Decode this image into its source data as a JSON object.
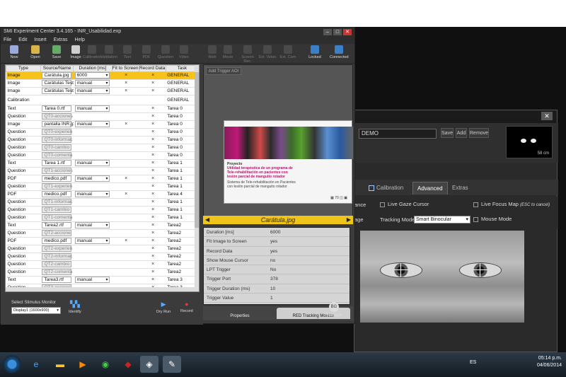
{
  "app": {
    "title": "SMI Experiment Center 3.4.165 - INR_Usabilidad.exp",
    "menu": [
      "File",
      "Edit",
      "Insert",
      "Extras",
      "Help"
    ]
  },
  "toolbar": {
    "items": [
      {
        "label": "New",
        "enabled": true
      },
      {
        "label": "Open",
        "enabled": true
      },
      {
        "label": "Save",
        "enabled": true
      },
      {
        "label": "Image",
        "enabled": true
      },
      {
        "label": "Calibration",
        "enabled": false
      },
      {
        "label": "Validation",
        "enabled": false
      },
      {
        "label": "Text",
        "enabled": false
      },
      {
        "label": "PDF",
        "enabled": false
      },
      {
        "label": "Question",
        "enabled": false
      },
      {
        "label": "Video",
        "enabled": false
      },
      {
        "label": "Web",
        "enabled": false
      },
      {
        "label": "Movie",
        "enabled": false
      },
      {
        "label": "Screen Rec.",
        "enabled": false
      },
      {
        "label": "Ext. Video",
        "enabled": false
      },
      {
        "label": "Ext. Cam",
        "enabled": false
      },
      {
        "label": "Locked",
        "enabled": true
      },
      {
        "label": "Connected",
        "enabled": true
      }
    ]
  },
  "table": {
    "headers": [
      "Type",
      "Source/Name",
      "Duration [ms]",
      "Fit to Screen",
      "Record Data",
      "Task"
    ],
    "rows": [
      {
        "type": "Image",
        "name": "Carátula.jpg",
        "duration": "6000",
        "fit": "×",
        "record": "×",
        "task": "GENERAL",
        "selected": true
      },
      {
        "type": "Image",
        "name": "Carátulas Test.",
        "duration": "manual",
        "fit": "×",
        "record": "×",
        "task": "GENERAL"
      },
      {
        "type": "Image",
        "name": "Carátulas Test1",
        "duration": "manual",
        "fit": "×",
        "record": "×",
        "task": "GENERAL"
      },
      {
        "type": "Calibration",
        "name": "",
        "duration": "",
        "fit": "",
        "record": "",
        "task": "GENERAL"
      },
      {
        "type": "Text",
        "name": "Tarea 0.rtf",
        "duration": "manual",
        "fit": "",
        "record": "×",
        "task": "Tarea 0"
      },
      {
        "type": "Question",
        "name": "QT0-acciones",
        "duration": "",
        "fit": "",
        "record": "×",
        "task": "Tarea 0"
      },
      {
        "type": "Image",
        "name": "pantalla INR.jp",
        "duration": "manual",
        "fit": "×",
        "record": "×",
        "task": "Tarea 0"
      },
      {
        "type": "Question",
        "name": "QT0-experien",
        "duration": "",
        "fit": "",
        "record": "×",
        "task": "Tarea 0"
      },
      {
        "type": "Question",
        "name": "QT0-informac",
        "duration": "",
        "fit": "",
        "record": "×",
        "task": "Tarea 0"
      },
      {
        "type": "Question",
        "name": "QT0-cambio",
        "duration": "",
        "fit": "",
        "record": "×",
        "task": "Tarea 0"
      },
      {
        "type": "Question",
        "name": "QT0-comenta",
        "duration": "",
        "fit": "",
        "record": "×",
        "task": "Tarea 0"
      },
      {
        "type": "Text",
        "name": "Tarea 1.rtf",
        "duration": "manual",
        "fit": "",
        "record": "×",
        "task": "Tarea 1"
      },
      {
        "type": "Question",
        "name": "QT1-acciones",
        "duration": "",
        "fit": "",
        "record": "×",
        "task": "Tarea 1"
      },
      {
        "type": "PDF",
        "name": "medico.pdf",
        "duration": "manual",
        "fit": "×",
        "record": "×",
        "task": "Tarea 1"
      },
      {
        "type": "Question",
        "name": "QT1-experien",
        "duration": "",
        "fit": "",
        "record": "×",
        "task": "Tarea 1"
      },
      {
        "type": "PDF",
        "name": "medico.pdf",
        "duration": "manual",
        "fit": "×",
        "record": "×",
        "task": "Tarea 4"
      },
      {
        "type": "Question",
        "name": "QT1-informac",
        "duration": "",
        "fit": "",
        "record": "×",
        "task": "Tarea 1"
      },
      {
        "type": "Question",
        "name": "QT1-cambio",
        "duration": "",
        "fit": "",
        "record": "×",
        "task": "Tarea 1"
      },
      {
        "type": "Question",
        "name": "QT1-comenta",
        "duration": "",
        "fit": "",
        "record": "×",
        "task": "Tarea 1"
      },
      {
        "type": "Text",
        "name": "Tarea2.rtf",
        "duration": "manual",
        "fit": "",
        "record": "×",
        "task": "Tarea2"
      },
      {
        "type": "Question",
        "name": "QT2-accione",
        "duration": "",
        "fit": "",
        "record": "×",
        "task": "Tarea2"
      },
      {
        "type": "PDF",
        "name": "medico.pdf",
        "duration": "manual",
        "fit": "×",
        "record": "×",
        "task": "Tarea2"
      },
      {
        "type": "Question",
        "name": "QT2-experien",
        "duration": "",
        "fit": "",
        "record": "×",
        "task": "Tarea2"
      },
      {
        "type": "Question",
        "name": "QT2-informac",
        "duration": "",
        "fit": "",
        "record": "×",
        "task": "Tarea2"
      },
      {
        "type": "Question",
        "name": "QT2-cambio",
        "duration": "",
        "fit": "",
        "record": "×",
        "task": "Tarea2"
      },
      {
        "type": "Question",
        "name": "QT2-comenta",
        "duration": "",
        "fit": "",
        "record": "×",
        "task": "Tarea2"
      },
      {
        "type": "Text",
        "name": "Tarea3.rtf",
        "duration": "manual",
        "fit": "",
        "record": "×",
        "task": "Tarea 3"
      },
      {
        "type": "Question",
        "name": "QT3-accione",
        "duration": "",
        "fit": "",
        "record": "×",
        "task": "Tarea 3"
      },
      {
        "type": "PDF",
        "name": "medico.pdf",
        "duration": "manual",
        "fit": "×",
        "record": "×",
        "task": "Tarea 3"
      }
    ]
  },
  "preview": {
    "add_trigger": "Add Trigger AOI",
    "slide_title": "Proyecto",
    "slide_subtitle": "Utilidad terapéutica de un programa de Tele-rehabilitación en pacientes con lesión parcial de manguito rotador",
    "slide_line2": "Sistema de Tele-rehabilitación en Pacientes con lesión parcial de manguito rotador",
    "stimulus_name": "Carátula.jpg"
  },
  "properties": {
    "rows": [
      {
        "key": "Duration [ms]",
        "value": "6000"
      },
      {
        "key": "Fit Image to Screen",
        "value": "yes"
      },
      {
        "key": "Record Data",
        "value": "yes"
      },
      {
        "key": "Show Mouse Cursor",
        "value": "no"
      },
      {
        "key": "LPT Trigger",
        "value": "No"
      },
      {
        "key": "Trigger Port",
        "value": "378"
      },
      {
        "key": "Trigger Duration (ms)",
        "value": "10"
      },
      {
        "key": "Trigger Value",
        "value": "1"
      }
    ],
    "tabs": [
      "Properties",
      "RED Tracking Monitor"
    ]
  },
  "bottom": {
    "select_monitor_label": "Select Stimulus Monitor",
    "monitor_value": "Display1 (1600x900)",
    "identify": "Identify",
    "dry_run": "Dry Run",
    "record": "Record",
    "begaze": "BeGaze"
  },
  "second_window": {
    "profile": "DEMO",
    "save": "Save",
    "add": "Add",
    "remove": "Remove",
    "distance": "58 cm",
    "tabs": [
      "Calibration",
      "Advanced",
      "Extras"
    ],
    "opt_performance": "ance",
    "opt_live_gaze": "Live Gaze Cursor",
    "opt_live_focus": "Live Focus Map",
    "opt_live_focus_hint": "(ESC to cancel)",
    "opt_image": "age",
    "tracking_mode_label": "Tracking Mode",
    "tracking_mode_value": "Smart Binocular",
    "opt_mouse_mode": "Mouse Mode"
  },
  "taskbar": {
    "lang": "ES",
    "time": "05:14 p.m.",
    "date": "04/06/2014"
  }
}
